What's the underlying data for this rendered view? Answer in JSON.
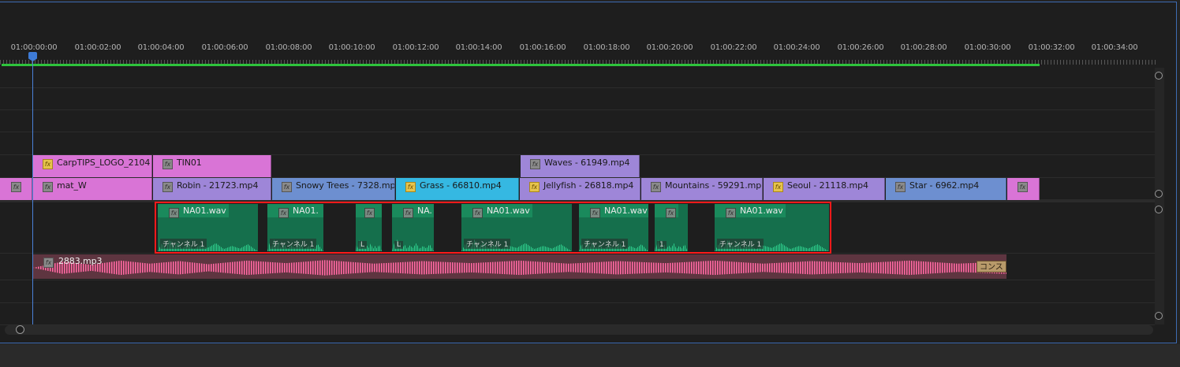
{
  "ruler": {
    "timecodes": [
      "01:00:00:00",
      "01:00:02:00",
      "01:00:04:00",
      "01:00:06:00",
      "01:00:08:00",
      "01:00:10:00",
      "01:00:12:00",
      "01:00:14:00",
      "01:00:16:00",
      "01:00:18:00",
      "01:00:20:00",
      "01:00:22:00",
      "01:00:24:00",
      "01:00:26:00",
      "01:00:28:00",
      "01:00:30:00",
      "01:00:32:00",
      "01:00:34:00"
    ]
  },
  "video_track_2": {
    "clips": [
      {
        "label": "CarpTIPS_LOGO_2104",
        "fx": "fx"
      },
      {
        "label": "TIN01",
        "fx": "fx"
      },
      {
        "label": "Waves - 61949.mp4",
        "fx": "fx"
      }
    ]
  },
  "video_track_1": {
    "clips": [
      {
        "label": "",
        "fx": "fx"
      },
      {
        "label": "mat_W",
        "fx": "fx"
      },
      {
        "label": "Robin - 21723.mp4",
        "fx": "fx"
      },
      {
        "label": "Snowy Trees - 7328.mp",
        "fx": "fx"
      },
      {
        "label": "Grass - 66810.mp4",
        "fx": "fx"
      },
      {
        "label": "Jellyfish - 26818.mp4",
        "fx": "fx"
      },
      {
        "label": "Mountains - 59291.mp",
        "fx": "fx"
      },
      {
        "label": "Seoul - 21118.mp4",
        "fx": "fx"
      },
      {
        "label": "Star - 6962.mp4",
        "fx": "fx"
      },
      {
        "label": "",
        "fx": "fx"
      }
    ]
  },
  "audio_track_1": {
    "clips": [
      {
        "label": "NA01.wav",
        "channel": "チャンネル 1",
        "fx": "fx"
      },
      {
        "label": "NA01.",
        "channel": "チャンネル 1",
        "fx": "fx"
      },
      {
        "label": "",
        "channel": "L",
        "fx": "fx"
      },
      {
        "label": "NA.",
        "channel": "L",
        "fx": "fx"
      },
      {
        "label": "NA01.wav",
        "channel": "チャンネル 1",
        "fx": "fx"
      },
      {
        "label": "NA01.wav",
        "channel": "チャンネル 1",
        "fx": "fx"
      },
      {
        "label": "",
        "channel": "1",
        "fx": "fx"
      },
      {
        "label": "NA01.wav",
        "channel": "チャンネル 1",
        "fx": "fx"
      }
    ]
  },
  "audio_track_2": {
    "clip": {
      "label": "2883.mp3",
      "fx": "fx",
      "tail_label": "コンス"
    }
  },
  "colors": {
    "work_area": "#2ec43c",
    "playhead": "#4a82d8",
    "selection": "#ff1a1a",
    "audio_clip": "#156f4c",
    "music_wave": "#ff6fa4"
  }
}
